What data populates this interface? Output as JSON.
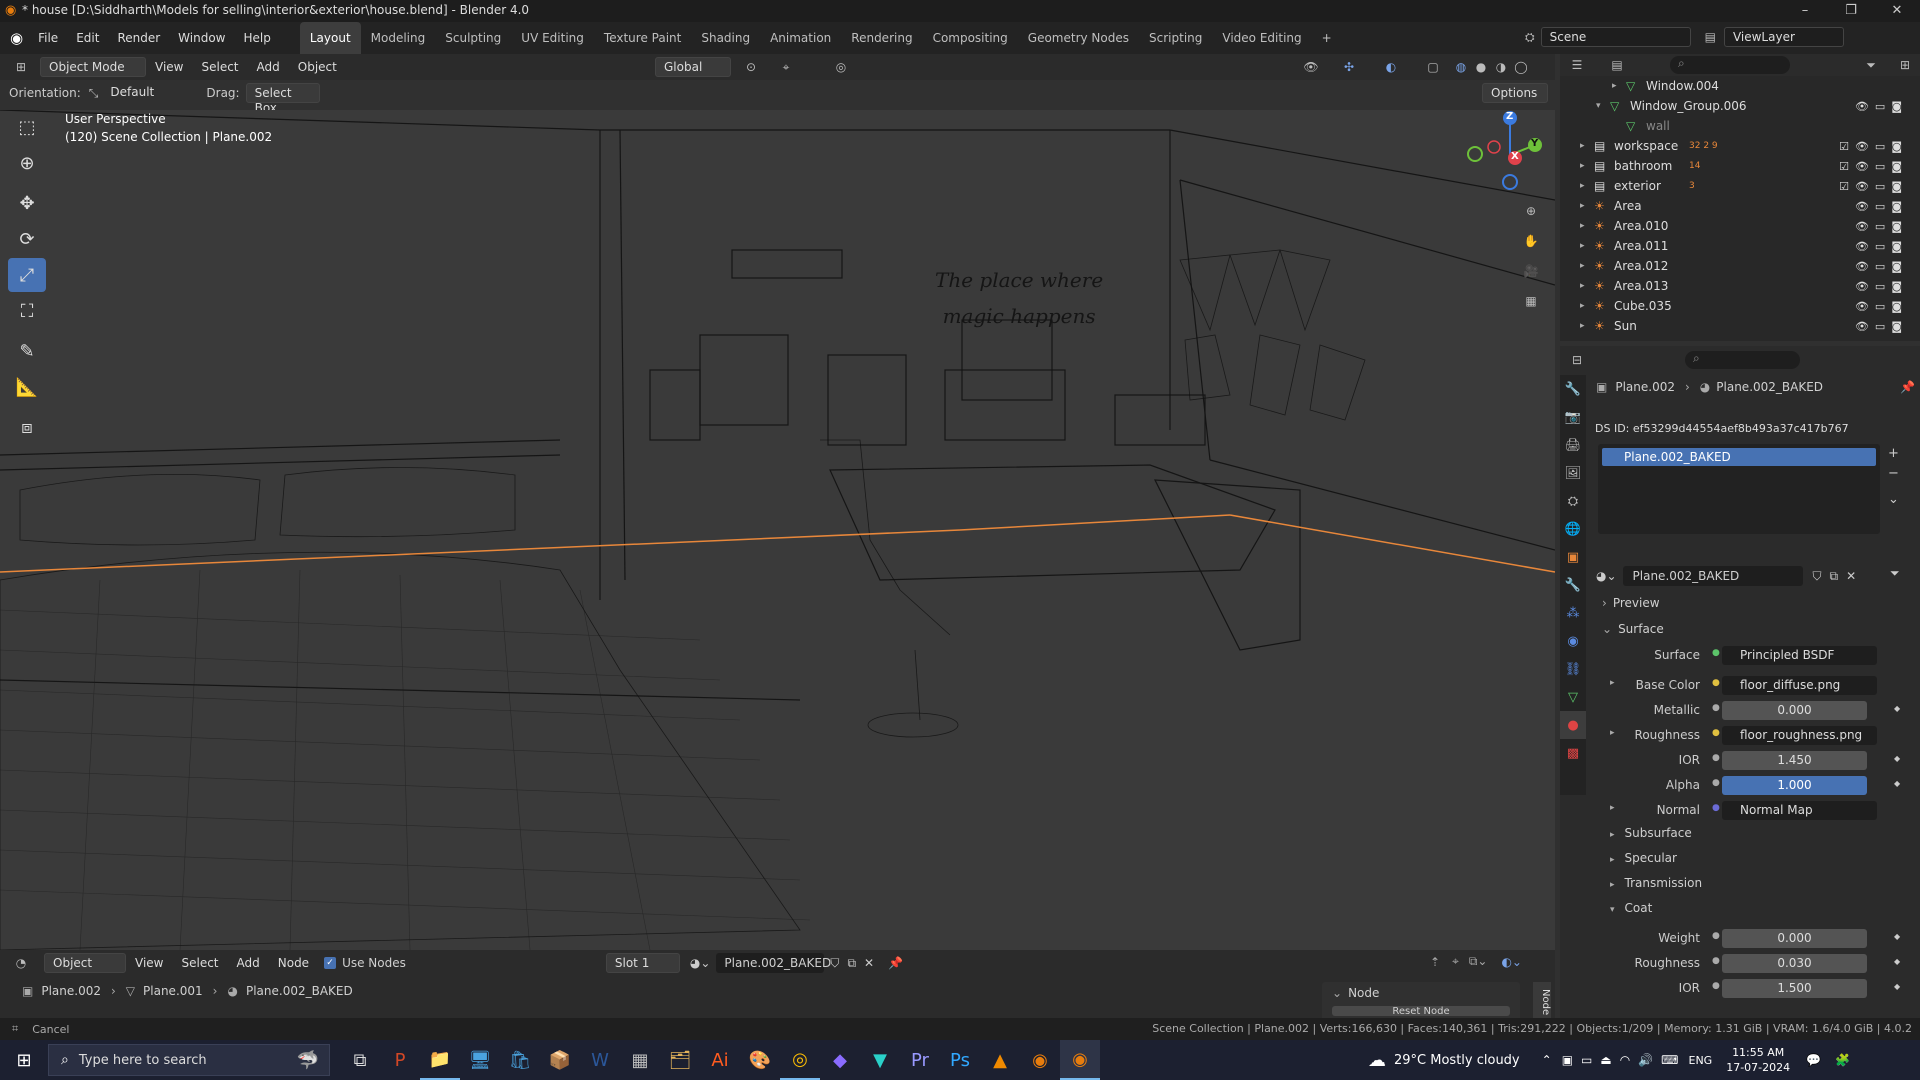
{
  "titlebar": {
    "title": "* house [D:\\Siddharth\\Models for selling\\interior&exterior\\house.blend] - Blender 4.0"
  },
  "menu": [
    "File",
    "Edit",
    "Render",
    "Window",
    "Help"
  ],
  "workspaces": [
    "Layout",
    "Modeling",
    "Sculpting",
    "UV Editing",
    "Texture Paint",
    "Shading",
    "Animation",
    "Rendering",
    "Compositing",
    "Geometry Nodes",
    "Scripting",
    "Video Editing"
  ],
  "scene": {
    "scene_name": "Scene",
    "viewlayer": "ViewLayer"
  },
  "viewport_header": {
    "mode": "Object Mode",
    "menus": [
      "View",
      "Select",
      "Add",
      "Object"
    ],
    "transform": "Global",
    "options": "Options"
  },
  "tool_settings": {
    "orientation_label": "Orientation:",
    "orientation": "Default",
    "drag_label": "Drag:",
    "drag": "Select Box"
  },
  "overlay": {
    "perspective": "User Perspective",
    "collection": "(120) Scene Collection | Plane.002"
  },
  "wall_text": {
    "line1": "The place where",
    "line2": "magic happens"
  },
  "gizmo": {
    "x": "X",
    "y": "Y",
    "z": "Z"
  },
  "outliner": {
    "rows": [
      {
        "name": "Window.004",
        "indent": 3
      },
      {
        "name": "Window_Group.006",
        "indent": 2
      },
      {
        "name": "wall",
        "indent": 3
      },
      {
        "name": "workspace",
        "indent": 1,
        "badge": "32 2 9"
      },
      {
        "name": "bathroom",
        "indent": 1,
        "badge": "14"
      },
      {
        "name": "exterior",
        "indent": 1,
        "badge": "3"
      },
      {
        "name": "Area",
        "indent": 1
      },
      {
        "name": "Area.010",
        "indent": 1
      },
      {
        "name": "Area.011",
        "indent": 1
      },
      {
        "name": "Area.012",
        "indent": 1
      },
      {
        "name": "Area.013",
        "indent": 1
      },
      {
        "name": "Cube.035",
        "indent": 1
      },
      {
        "name": "Sun",
        "indent": 1
      }
    ]
  },
  "properties": {
    "breadcrumb_object": "Plane.002",
    "breadcrumb_material": "Plane.002_BAKED",
    "ds_id": "DS ID: ef53299d44554aef8b493a37c417b767",
    "slot_item": "Plane.002_BAKED",
    "material_name": "Plane.002_BAKED",
    "preview": "Preview",
    "surface_panel": "Surface",
    "fields": [
      {
        "label": "Surface",
        "value": "Principled BSDF",
        "type": "link"
      },
      {
        "label": "Base Color",
        "value": "floor_diffuse.png",
        "type": "link"
      },
      {
        "label": "Metallic",
        "value": "0.000",
        "type": "num"
      },
      {
        "label": "Roughness",
        "value": "floor_roughness.png",
        "type": "link"
      },
      {
        "label": "IOR",
        "value": "1.450",
        "type": "num"
      },
      {
        "label": "Alpha",
        "value": "1.000",
        "type": "blue"
      },
      {
        "label": "Normal",
        "value": "Normal Map",
        "type": "link"
      }
    ],
    "subpanels": [
      "Subsurface",
      "Specular",
      "Transmission",
      "Coat"
    ],
    "coat_fields": [
      {
        "label": "Weight",
        "value": "0.000"
      },
      {
        "label": "Roughness",
        "value": "0.030"
      },
      {
        "label": "IOR",
        "value": "1.500"
      }
    ]
  },
  "node_editor": {
    "type": "Object",
    "menus": [
      "View",
      "Select",
      "Add",
      "Node"
    ],
    "use_nodes": "Use Nodes",
    "slot": "Slot 1",
    "material": "Plane.002_BAKED",
    "breadcrumb": [
      "Plane.002",
      "Plane.001",
      "Plane.002_BAKED"
    ],
    "node_panel": "Node",
    "reset": "Reset Node",
    "side_tab": "Node"
  },
  "statusbar": {
    "left": "Cancel",
    "right": "Scene Collection | Plane.002 | Verts:166,630 | Faces:140,361 | Tris:291,222 | Objects:1/209 | Memory: 1.31 GiB | VRAM: 1.6/4.0 GiB | 4.0.2"
  },
  "taskbar": {
    "search_placeholder": "Type here to search",
    "weather": "29°C  Mostly cloudy",
    "lang": "ENG",
    "time": "11:55 AM",
    "date": "17-07-2024"
  },
  "colors": {
    "accent": "#4772b3",
    "selection_orange": "#e8873a",
    "bg": "#303030"
  }
}
